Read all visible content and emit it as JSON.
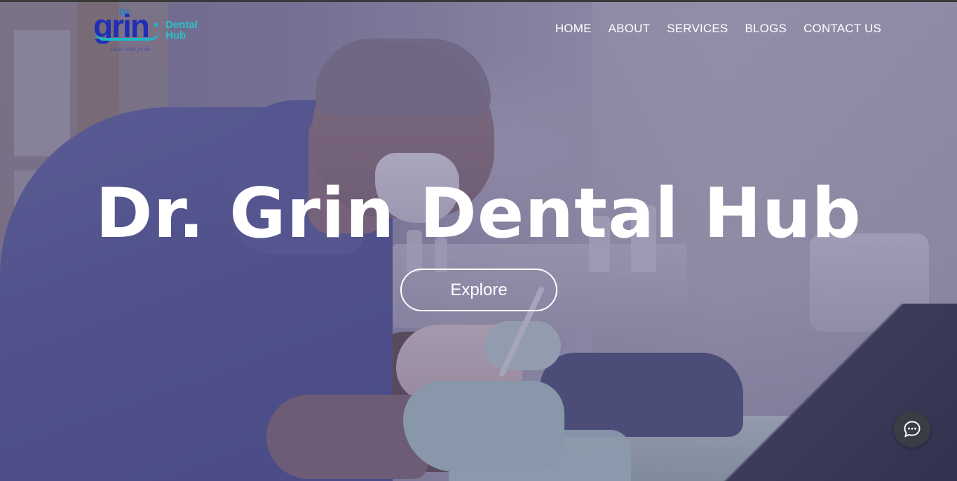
{
  "brand": {
    "logo_dr": "Dr",
    "logo_grin": "grin",
    "logo_dental": "Dental",
    "logo_hub": "Hub",
    "logo_tagline": "smile with pride",
    "colors": {
      "primary": "#1f2fb6",
      "accent": "#2dbfc9"
    }
  },
  "nav": {
    "items": [
      {
        "label": "HOME"
      },
      {
        "label": "ABOUT"
      },
      {
        "label": "SERVICES"
      },
      {
        "label": "BLOGS"
      },
      {
        "label": "CONTACT US"
      }
    ]
  },
  "hero": {
    "title": "Dr. Grin Dental Hub",
    "cta_label": "Explore"
  },
  "chat_widget": {
    "icon": "chat-bubble-icon"
  }
}
